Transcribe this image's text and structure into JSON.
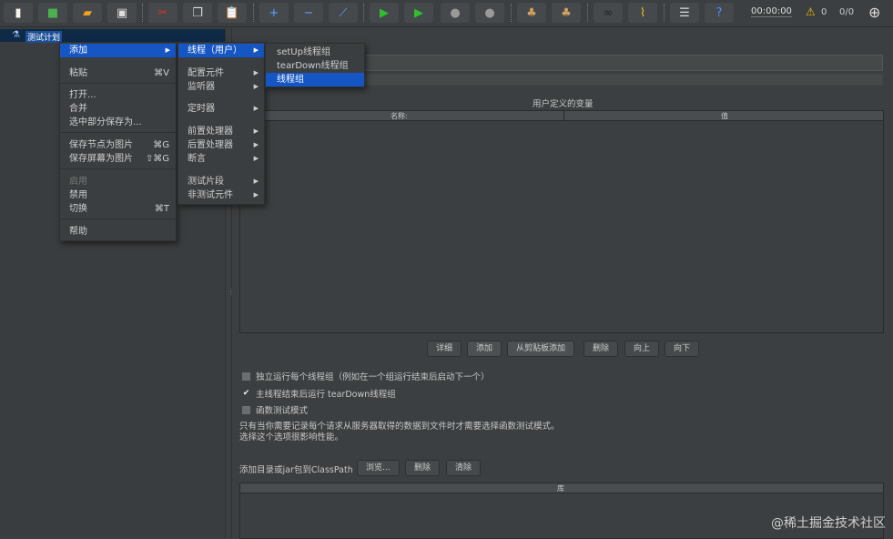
{
  "toolbar": {
    "icons": [
      "new-icon",
      "templates-icon",
      "open-icon",
      "save-icon",
      "cut-icon",
      "copy-icon",
      "paste-icon",
      "expand-icon",
      "collapse-icon",
      "toggle-icon",
      "start-icon",
      "start-no-pause-icon",
      "stop-icon",
      "shutdown-icon",
      "clear-icon",
      "clear-all-icon",
      "search-icon",
      "reset-search-icon",
      "function-helper-icon",
      "help-icon"
    ],
    "timer": "00:00:00",
    "warnings": "0",
    "threads": "0/0"
  },
  "tree": {
    "root": "测试计划"
  },
  "context_menu": {
    "items": [
      {
        "label": "添加"
      },
      {
        "label": "粘贴",
        "shortcut": "⌘V"
      },
      {
        "label": "打开..."
      },
      {
        "label": "合并"
      },
      {
        "label": "选中部分保存为..."
      },
      {
        "label": "保存节点为图片",
        "shortcut": "⌘G"
      },
      {
        "label": "保存屏幕为图片",
        "shortcut": "⇧⌘G"
      },
      {
        "label": "启用"
      },
      {
        "label": "禁用"
      },
      {
        "label": "切换",
        "shortcut": "⌘T"
      },
      {
        "label": "帮助"
      }
    ]
  },
  "add_submenu": {
    "items": [
      "线程（用户）",
      "配置元件",
      "监听器",
      "定时器",
      "前置处理器",
      "后置处理器",
      "断言",
      "测试片段",
      "非测试元件"
    ]
  },
  "thread_submenu": {
    "items": [
      "setUp线程组",
      "tearDown线程组",
      "线程组"
    ]
  },
  "main": {
    "variables_title": "用户定义的变量",
    "col_name": "名称:",
    "col_value": "值",
    "buttons": [
      "详细",
      "添加",
      "从剪贴板添加",
      "删除",
      "向上",
      "向下"
    ],
    "checkboxes": [
      {
        "label": "独立运行每个线程组（例如在一个组运行结束后启动下一个）",
        "checked": false
      },
      {
        "label": "主线程结束后运行 tearDown线程组",
        "checked": true
      },
      {
        "label": "函数测试模式",
        "checked": false
      }
    ],
    "note1": "只有当你需要记录每个请求从服务器取得的数据到文件时才需要选择函数测试模式。",
    "note2": "选择这个选项很影响性能。",
    "classpath_label": "添加目录或jar包到ClassPath",
    "classpath_buttons": [
      "浏览...",
      "删除",
      "清除"
    ],
    "lib_header": "库"
  },
  "watermark": "@稀土掘金技术社区"
}
